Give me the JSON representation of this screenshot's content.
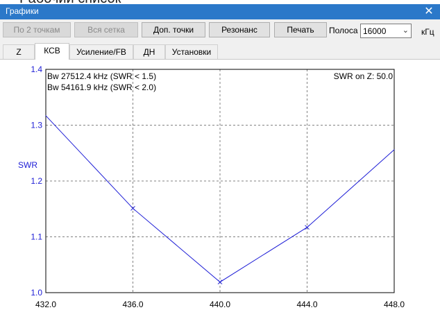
{
  "background_text": "Рабочий список",
  "window": {
    "title": "Графики"
  },
  "toolbar": {
    "by_two_points": "По 2 точкам",
    "full_grid": "Вся сетка",
    "extra_points": "Доп. точки",
    "resonance": "Резонанс",
    "print": "Печать",
    "band_label": "Полоса",
    "band_value": "16000",
    "band_unit": "кГц"
  },
  "tabs": [
    {
      "label": "Z",
      "active": false
    },
    {
      "label": "КСВ",
      "active": true
    },
    {
      "label": "Усиление/FB",
      "active": false
    },
    {
      "label": "ДН",
      "active": false
    },
    {
      "label": "Установки",
      "active": false
    }
  ],
  "colors": {
    "series": "#1c1cd6",
    "axis_label": "#1c1cd6",
    "title_bar": "#2b78c9"
  },
  "chart_data": {
    "type": "line",
    "ylabel": "SWR",
    "xlabel": "",
    "xlim": [
      432.0,
      448.0
    ],
    "ylim": [
      1.0,
      1.4
    ],
    "x_ticks": [
      "432.0",
      "436.0",
      "440.0",
      "444.0",
      "448.0"
    ],
    "y_ticks": [
      "1.0",
      "1.1",
      "1.2",
      "1.3",
      "1.4"
    ],
    "grid": true,
    "series": [
      {
        "x": [
          432.0,
          436.0,
          440.0,
          444.0,
          448.0
        ],
        "y": [
          1.317,
          1.151,
          1.019,
          1.117,
          1.256
        ],
        "markers": [
          false,
          true,
          true,
          true,
          false
        ]
      }
    ],
    "annotations": {
      "bw1": "Bw 27512.4 kHz (SWR < 1.5)",
      "bw2": "Bw 54161.9 kHz (SWR < 2.0)",
      "swr_on_z": "SWR on Z: 50.0"
    }
  }
}
